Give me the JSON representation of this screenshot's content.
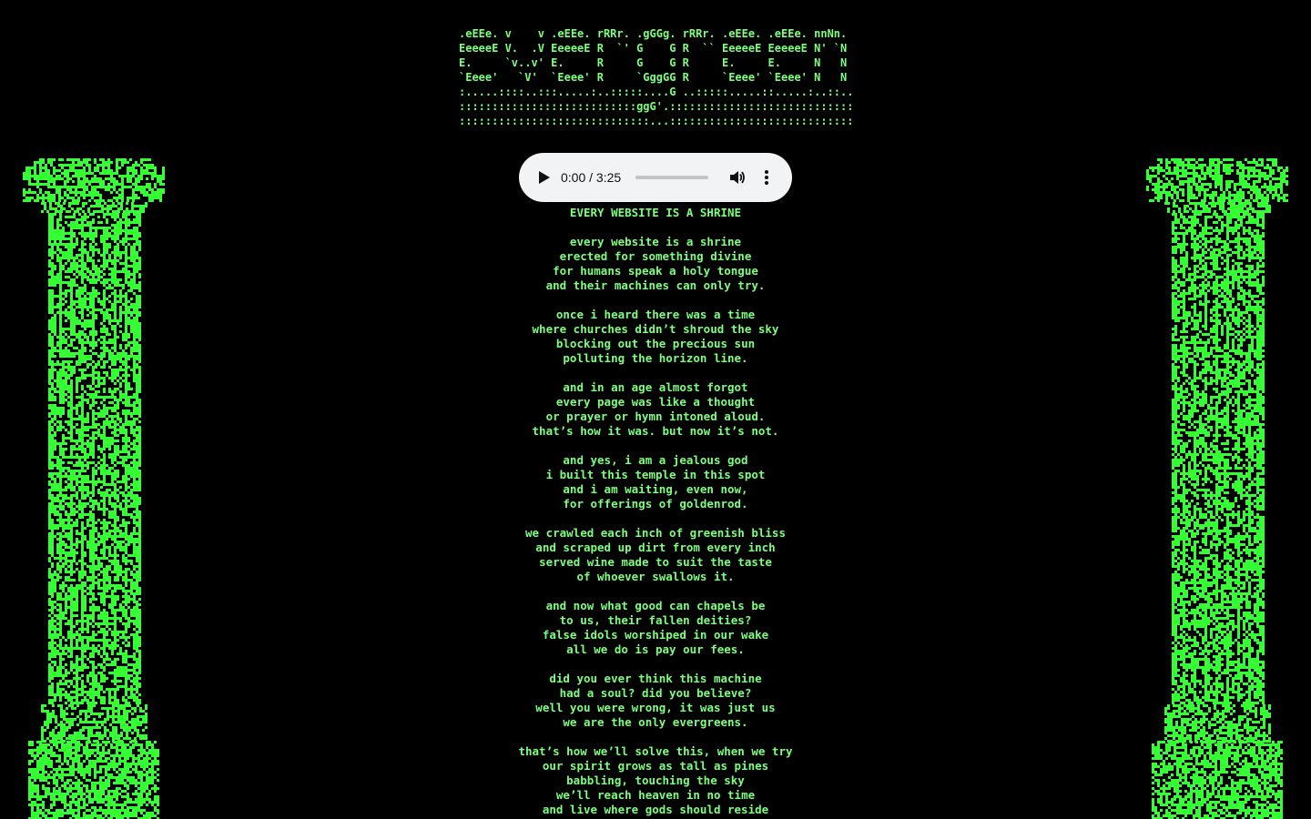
{
  "banner": {
    "lines": [
      ".eEEe. v    v .eEEe. rRRr. .gGGg. rRRr. .eEEe. .eEEe. nnNn.",
      "EeeeeE V.  .V EeeeeE R  `' G    G R  `` EeeeeE EeeeeE N' `N",
      "E.     `v..v' E.     R     G    G R     E.     E.     N   N",
      "`Eeee'   `V'  `Eeee' R     `GggGG R     `Eeee' `Eeee' N   N",
      ":.....::::..:::.....:..:::::....G ..:::::.....::.....:..::..",
      ":::::::::::::::::::::::::::ggG'.::::::::::::::::::::::::::::",
      ":::::::::::::::::::::::::::::...::::::::::::::::::::::::::::"
    ]
  },
  "player": {
    "time": "0:00 / 3:25",
    "progress": 0,
    "play_icon": "play-icon",
    "volume_icon": "volume-icon",
    "more_icon": "more-options-icon"
  },
  "poem": {
    "title": "EVERY WEBSITE IS A SHRINE",
    "stanzas": [
      [
        "every website is a shrine",
        "erected for something divine",
        "for humans speak a holy tongue",
        "and their machines can only try."
      ],
      [
        "once i heard there was a time",
        "where churches didn’t shroud the sky",
        "blocking out the precious sun",
        "polluting the horizon line."
      ],
      [
        "and in an age almost forgot",
        "every page was like a thought",
        "or prayer or hymn intoned aloud.",
        "that’s how it was. but now it’s not."
      ],
      [
        "and yes, i am a jealous god",
        "i built this temple in this spot",
        "and i am waiting, even now,",
        "for offerings of goldenrod."
      ],
      [
        "we crawled each inch of greenish bliss",
        "and scraped up dirt from every inch",
        "served wine made to suit the taste",
        "of whoever swallows it."
      ],
      [
        "and now what good can chapels be",
        "to us, their fallen deities?",
        "false idols worshiped in our wake",
        "all we do is pay our fees."
      ],
      [
        "did you ever think this machine",
        "had a soul? did you believe?",
        "well you were wrong, it was just us",
        "we are the only evergreens."
      ],
      [
        "that’s how we’ll solve this, when we try",
        "our spirit grows as tall as pines",
        "babbling, touching the sky",
        "we’ll reach heaven in no time",
        "and live where gods should reside"
      ]
    ]
  },
  "colors": {
    "background": "#000000",
    "text": "#7dff7d",
    "pillar_bright": "#33ff33",
    "pillar_dark": "#0a4a0a"
  }
}
